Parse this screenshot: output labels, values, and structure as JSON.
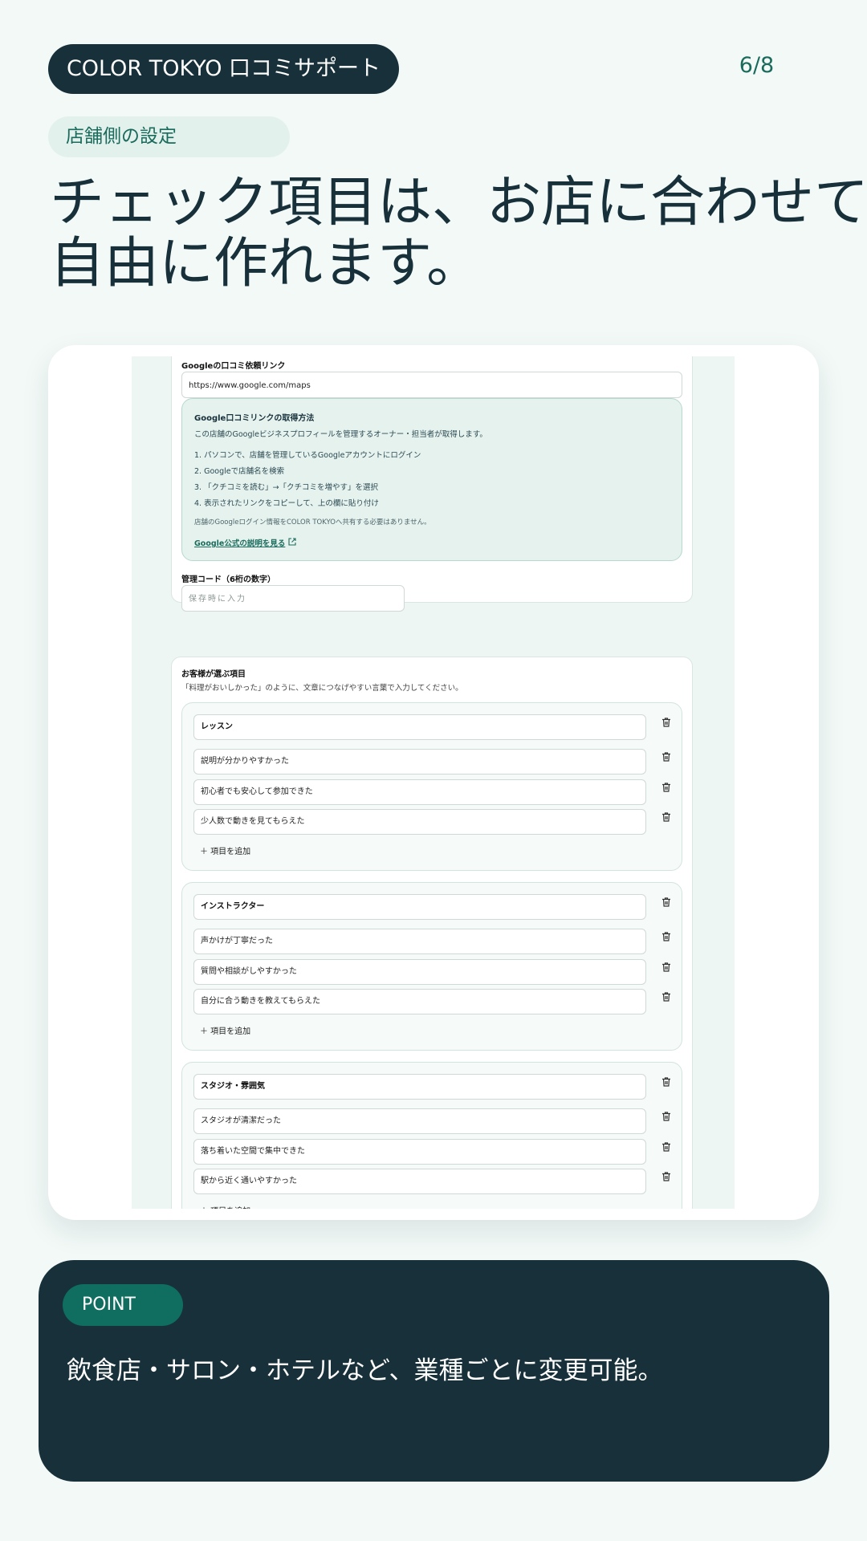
{
  "header": {
    "brand": "COLOR TOKYO  口コミサポート",
    "page_counter": "6/8",
    "section": "店舗側の設定",
    "headline_line1": "チェック項目は、お店に合わせて",
    "headline_line2": "自由に作れます。"
  },
  "screenshot": {
    "google_link": {
      "label": "Googleの口コミ依頼リンク",
      "value": "https://www.google.com/maps"
    },
    "help": {
      "title": "Google口コミリンクの取得方法",
      "intro": "この店舗のGoogleビジネスプロフィールを管理するオーナー・担当者が取得します。",
      "steps": [
        "1. パソコンで、店舗を管理しているGoogleアカウントにログイン",
        "2. Googleで店舗名を検索",
        "3. 「クチコミを読む」→「クチコミを増やす」を選択",
        "4. 表示されたリンクをコピーして、上の欄に貼り付け"
      ],
      "note": "店舗のGoogleログイン情報をCOLOR TOKYOへ共有する必要はありません。",
      "link": "Google公式の説明を見る"
    },
    "admin_code": {
      "label": "管理コード（6桁の数字）",
      "placeholder": "保存時に入力"
    },
    "customer_items": {
      "title": "お客様が選ぶ項目",
      "description": "「料理がおいしかった」のように、文章につなげやすい言葉で入力してください。",
      "add_label": "＋ 項目を追加",
      "groups": [
        {
          "name": "レッスン",
          "items": [
            "説明が分かりやすかった",
            "初心者でも安心して参加できた",
            "少人数で動きを見てもらえた"
          ]
        },
        {
          "name": "インストラクター",
          "items": [
            "声かけが丁寧だった",
            "質問や相談がしやすかった",
            "自分に合う動きを教えてもらえた"
          ]
        },
        {
          "name": "スタジオ・雰囲気",
          "items": [
            "スタジオが清潔だった",
            "落ち着いた空間で集中できた",
            "駅から近く通いやすかった"
          ]
        }
      ]
    }
  },
  "point": {
    "badge": "POINT",
    "text": "飲食店・サロン・ホテルなど、業種ごとに変更可能。"
  },
  "colors": {
    "background": "#f2f9f7",
    "dark": "#17303a",
    "accent": "#0f6e5f",
    "chip": "#e2f1ec"
  }
}
